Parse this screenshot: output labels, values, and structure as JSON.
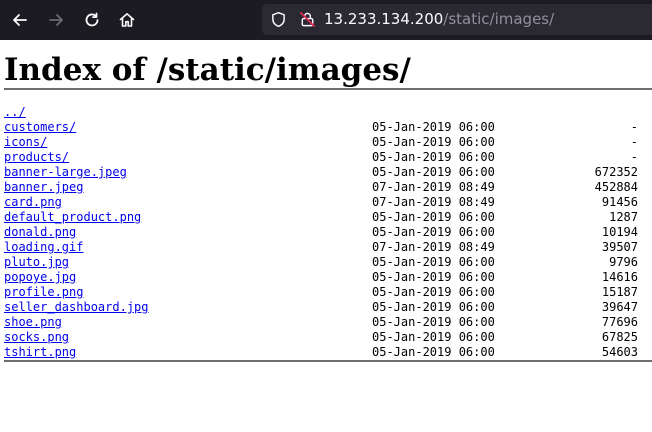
{
  "browser": {
    "url_host": "13.233.134.200",
    "url_path": "/static/images/"
  },
  "page": {
    "title": "Index of /static/images/"
  },
  "colors": {
    "toolbar_bg": "#1c1b22",
    "urlbar_bg": "#2b2a33",
    "link": "#0000ee"
  },
  "icons": {
    "back": "arrow-left-icon",
    "forward": "arrow-right-icon",
    "reload": "reload-icon",
    "home": "home-icon",
    "tracking": "shield-icon",
    "insecure": "lock-slash-icon"
  },
  "listing": [
    {
      "name": "../",
      "date": "",
      "size": ""
    },
    {
      "name": "customers/",
      "date": "05-Jan-2019 06:00",
      "size": "-"
    },
    {
      "name": "icons/",
      "date": "05-Jan-2019 06:00",
      "size": "-"
    },
    {
      "name": "products/",
      "date": "05-Jan-2019 06:00",
      "size": "-"
    },
    {
      "name": "banner-large.jpeg",
      "date": "05-Jan-2019 06:00",
      "size": "672352"
    },
    {
      "name": "banner.jpeg",
      "date": "07-Jan-2019 08:49",
      "size": "452884"
    },
    {
      "name": "card.png",
      "date": "07-Jan-2019 08:49",
      "size": "91456"
    },
    {
      "name": "default_product.png",
      "date": "05-Jan-2019 06:00",
      "size": "1287"
    },
    {
      "name": "donald.png",
      "date": "05-Jan-2019 06:00",
      "size": "10194"
    },
    {
      "name": "loading.gif",
      "date": "07-Jan-2019 08:49",
      "size": "39507"
    },
    {
      "name": "pluto.jpg",
      "date": "05-Jan-2019 06:00",
      "size": "9796"
    },
    {
      "name": "popoye.jpg",
      "date": "05-Jan-2019 06:00",
      "size": "14616"
    },
    {
      "name": "profile.png",
      "date": "05-Jan-2019 06:00",
      "size": "15187"
    },
    {
      "name": "seller_dashboard.jpg",
      "date": "05-Jan-2019 06:00",
      "size": "39647"
    },
    {
      "name": "shoe.png",
      "date": "05-Jan-2019 06:00",
      "size": "77696"
    },
    {
      "name": "socks.png",
      "date": "05-Jan-2019 06:00",
      "size": "67825"
    },
    {
      "name": "tshirt.png",
      "date": "05-Jan-2019 06:00",
      "size": "54603"
    }
  ]
}
